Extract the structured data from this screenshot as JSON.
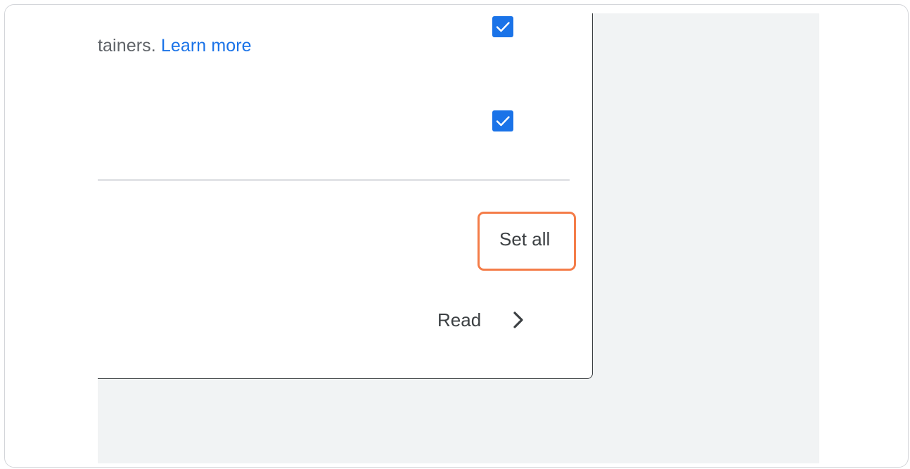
{
  "description": {
    "text_fragment": "tainers.",
    "link_label": "Learn more"
  },
  "checkboxes": [
    {
      "checked": true
    },
    {
      "checked": true
    }
  ],
  "actions": {
    "set_all_label": "Set all",
    "read_label": "Read"
  },
  "colors": {
    "accent": "#1a73e8",
    "highlight": "#f47c48",
    "background_gray": "#f1f3f4",
    "text": "#3c4043"
  },
  "icons": {
    "checkbox_mark": "check-icon",
    "read_arrow": "chevron-right-icon"
  }
}
